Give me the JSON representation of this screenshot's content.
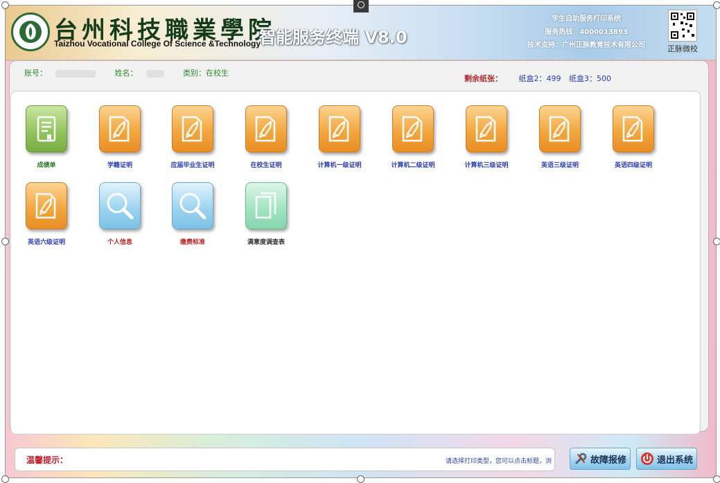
{
  "header": {
    "school_cn": "台州科技職業學院",
    "school_en": "Taizhou Vocational College Of Science &Technology",
    "terminal_title": "智能服务终端 V8.0",
    "system_name": "学生自助服务打印系统",
    "hotline": "服务热线：4000013893",
    "support": "技术支持：广州正脉教育技术有限公司",
    "qr_label": "正脉微校"
  },
  "user": {
    "account_label": "账号：",
    "name_label": "姓名：",
    "category": "类别：在校生"
  },
  "paper": {
    "label": "剩余纸张：",
    "box2": "纸盒2：499",
    "box3": "纸盒3：500"
  },
  "tiles": [
    {
      "label": "成绩单",
      "style": "green",
      "icon": "transcript-icon",
      "caption_color": "green"
    },
    {
      "label": "学籍证明",
      "style": "orange",
      "icon": "certificate-icon",
      "caption_color": "blue"
    },
    {
      "label": "应届毕业生证明",
      "style": "orange",
      "icon": "certificate-icon",
      "caption_color": "blue"
    },
    {
      "label": "在校生证明",
      "style": "orange",
      "icon": "certificate-icon",
      "caption_color": "blue"
    },
    {
      "label": "计算机一级证明",
      "style": "orange",
      "icon": "certificate-icon",
      "caption_color": "blue"
    },
    {
      "label": "计算机二级证明",
      "style": "orange",
      "icon": "certificate-icon",
      "caption_color": "blue"
    },
    {
      "label": "计算机三级证明",
      "style": "orange",
      "icon": "certificate-icon",
      "caption_color": "blue"
    },
    {
      "label": "英语三级证明",
      "style": "orange",
      "icon": "certificate-icon",
      "caption_color": "blue"
    },
    {
      "label": "英语四级证明",
      "style": "orange",
      "icon": "certificate-icon",
      "caption_color": "blue"
    },
    {
      "label": "英语六级证明",
      "style": "orange",
      "icon": "certificate-icon",
      "caption_color": "blue"
    },
    {
      "label": "个人信息",
      "style": "blue",
      "icon": "magnifier-icon",
      "caption_color": "red"
    },
    {
      "label": "缴费标准",
      "style": "blue",
      "icon": "magnifier-icon",
      "caption_color": "red"
    },
    {
      "label": "满意度调查表",
      "style": "mint",
      "icon": "survey-icon",
      "caption_color": "dark"
    }
  ],
  "footer": {
    "tip_label": "温馨提示：",
    "tip_text": "请选择打印类型，您可以点击标题，浏",
    "repair_button": "故障报修",
    "exit_button": "退出系统"
  },
  "colors": {
    "caption_blue": "#2a3fb6",
    "caption_red": "#c01e1e",
    "caption_green": "#2b7a2b",
    "tip_red": "#c41c2a"
  }
}
